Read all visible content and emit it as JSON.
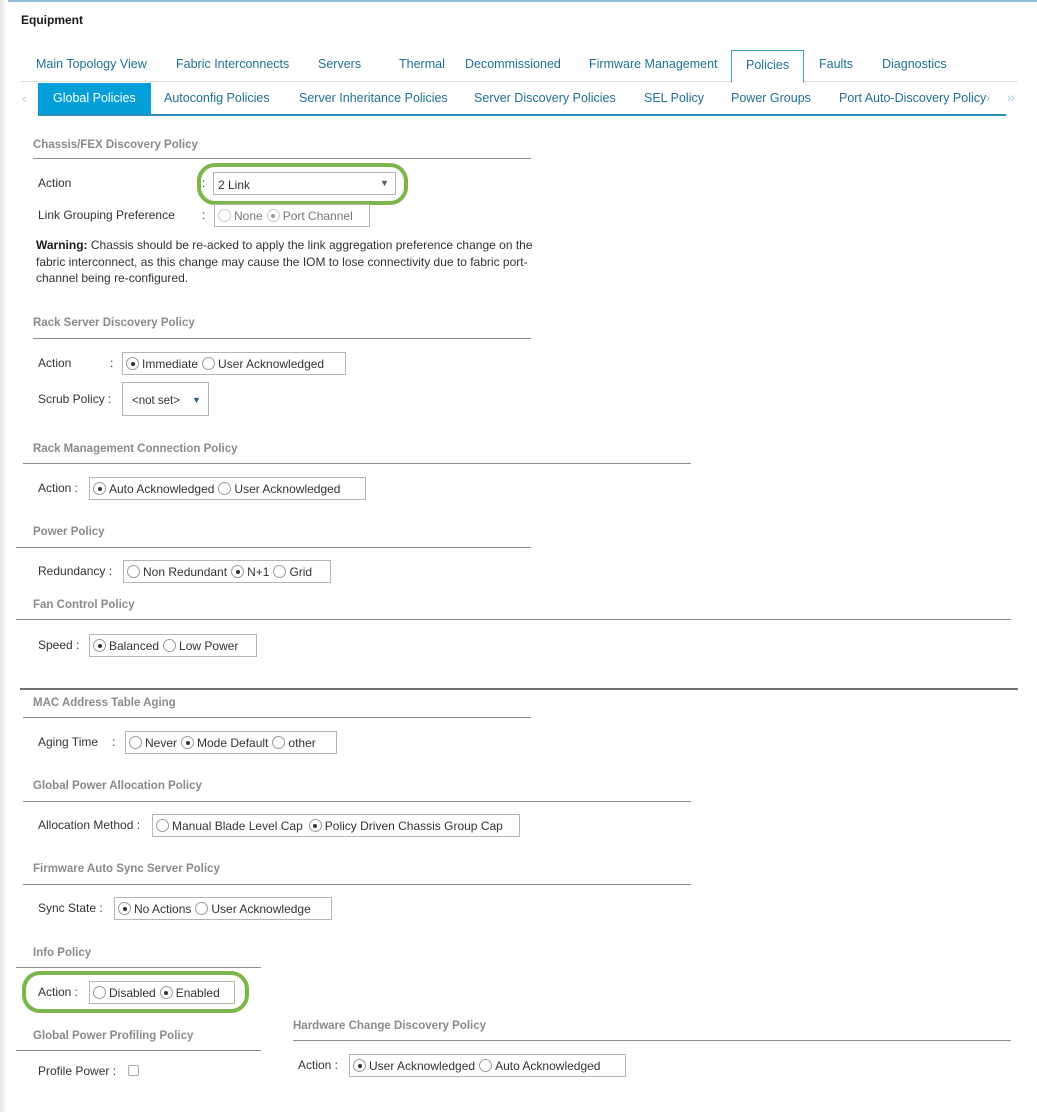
{
  "header": {
    "title": "Equipment"
  },
  "main_tabs": [
    {
      "label": "Main Topology View",
      "active": false
    },
    {
      "label": "Fabric Interconnects",
      "active": false
    },
    {
      "label": "Servers",
      "active": false
    },
    {
      "label": "Thermal",
      "active": false
    },
    {
      "label": "Decommissioned",
      "active": false
    },
    {
      "label": "Firmware Management",
      "active": false
    },
    {
      "label": "Policies",
      "active": true
    },
    {
      "label": "Faults",
      "active": false
    },
    {
      "label": "Diagnostics",
      "active": false
    }
  ],
  "sub_tabs": [
    {
      "label": "Global Policies",
      "active": true
    },
    {
      "label": "Autoconfig Policies",
      "active": false
    },
    {
      "label": "Server Inheritance Policies",
      "active": false
    },
    {
      "label": "Server Discovery Policies",
      "active": false
    },
    {
      "label": "SEL Policy",
      "active": false
    },
    {
      "label": "Power Groups",
      "active": false
    },
    {
      "label": "Port Auto-Discovery Policy",
      "active": false
    }
  ],
  "sub_tab_nav": {
    "prev": "‹",
    "next": "›",
    "more": "»"
  },
  "sections": {
    "chassis_fex": {
      "title": "Chassis/FEX Discovery Policy",
      "action_label": "Action",
      "action_value": "2 Link",
      "link_grouping_label": "Link Grouping Preference",
      "link_grouping_options": [
        "None",
        "Port Channel"
      ],
      "link_grouping_selected": "Port Channel",
      "warning_bold": "Warning:",
      "warning_text": " Chassis should be re-acked to apply the link aggregation preference change on the fabric interconnect, as this change may cause the IOM to lose connectivity due to fabric port-channel being re-configured."
    },
    "rack_server_discovery": {
      "title": "Rack Server Discovery Policy",
      "action_label": "Action",
      "action_options": [
        "Immediate",
        "User Acknowledged"
      ],
      "action_selected": "Immediate",
      "scrub_label": "Scrub Policy :",
      "scrub_value": "<not set>"
    },
    "rack_mgmt_connection": {
      "title": "Rack Management Connection Policy",
      "action_label": "Action :",
      "action_options": [
        "Auto Acknowledged",
        "User Acknowledged"
      ],
      "action_selected": "Auto Acknowledged"
    },
    "power_policy": {
      "title": "Power Policy",
      "redundancy_label": "Redundancy :",
      "options": [
        "Non Redundant",
        "N+1",
        "Grid"
      ],
      "selected": "N+1"
    },
    "fan_control": {
      "title": "Fan Control Policy",
      "speed_label": "Speed :",
      "options": [
        "Balanced",
        "Low Power"
      ],
      "selected": "Balanced"
    },
    "mac_aging": {
      "title": "MAC Address Table Aging",
      "aging_label": "Aging Time",
      "options": [
        "Never",
        "Mode Default",
        "other"
      ],
      "selected": "Mode Default"
    },
    "global_power_allocation": {
      "title": "Global Power Allocation Policy",
      "method_label": "Allocation Method :",
      "options": [
        "Manual Blade Level Cap",
        "Policy Driven Chassis Group Cap"
      ],
      "selected": "Policy Driven Chassis Group Cap"
    },
    "firmware_auto_sync": {
      "title": "Firmware Auto Sync Server Policy",
      "sync_label": "Sync State :",
      "options": [
        "No Actions",
        "User Acknowledge"
      ],
      "selected": "No Actions"
    },
    "info_policy": {
      "title": "Info Policy",
      "action_label": "Action :",
      "options": [
        "Disabled",
        "Enabled"
      ],
      "selected": "Enabled"
    },
    "global_power_profiling": {
      "title": "Global Power Profiling Policy",
      "profile_label": "Profile Power :",
      "checked": false
    },
    "hardware_change_discovery": {
      "title": "Hardware Change Discovery Policy",
      "action_label": "Action :",
      "options": [
        "User Acknowledged",
        "Auto Acknowledged"
      ],
      "selected": "User Acknowledged"
    }
  },
  "colon": ":",
  "colors": {
    "accent": "#049fd9",
    "tab_text": "#1f6f95",
    "highlight": "#7ab648"
  }
}
